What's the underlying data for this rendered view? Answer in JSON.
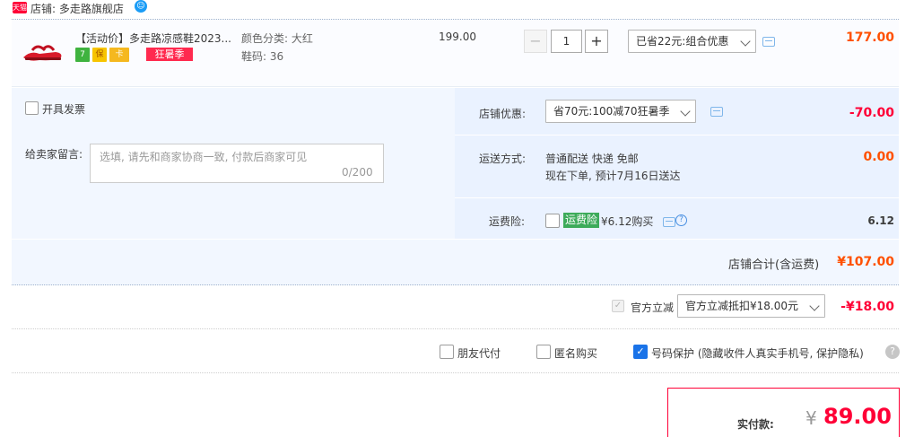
{
  "shop": {
    "badge": "天猫",
    "name": "店铺: 多走路旗舰店",
    "contact_icon": "wangwang-icon"
  },
  "item": {
    "title": "【活动价】多走路凉感鞋2023...",
    "service_icons": [
      "7",
      "保",
      "卡"
    ],
    "promo_tag": "狂暑季",
    "sku_color": "颜色分类: 大红",
    "sku_size": "鞋码: 36",
    "price": "199.00",
    "quantity": "1",
    "minus_label": "−",
    "plus_label": "+",
    "discount_select": "已省22元:组合优惠",
    "total": "177.00"
  },
  "invoice": {
    "label": "开具发票"
  },
  "message": {
    "label": "给卖家留言:",
    "placeholder": "选填, 请先和商家协商一致, 付款后商家可见",
    "counter": "0/200"
  },
  "shop_discount": {
    "label": "店铺优惠:",
    "select": "省70元:100减70狂暑季",
    "value": "-70.00"
  },
  "shipping": {
    "label": "运送方式:",
    "line1": "普通配送 快递 免邮",
    "line2": "现在下单, 预计7月16日送达",
    "value": "0.00"
  },
  "insurance": {
    "label": "运费险:",
    "tag": "运费险",
    "text": "¥6.12购买",
    "value": "6.12"
  },
  "shop_total": {
    "label": "店铺合计(含运费)",
    "value": "¥107.00"
  },
  "official_discount": {
    "label": "官方立减",
    "select": "官方立减抵扣¥18.00元",
    "value": "-¥18.00"
  },
  "options": {
    "friend_pay": "朋友代付",
    "anonymous": "匿名购买",
    "phone_protect": "号码保护 (隐藏收件人真实手机号, 保护隐私)"
  },
  "payment": {
    "label": "实付款:",
    "currency": "¥",
    "amount": "89.00"
  },
  "colors": {
    "accent_red": "#ff0036",
    "accent_orange": "#ff5000",
    "panel_blue": "#f2f7ff",
    "check_blue": "#1a73e8"
  }
}
